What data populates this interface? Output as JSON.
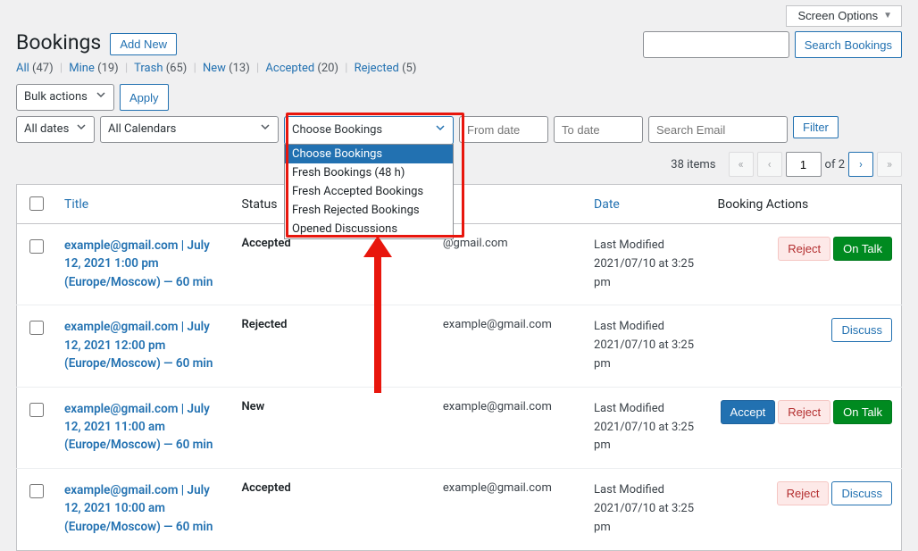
{
  "screen_options_label": "Screen Options",
  "page_title": "Bookings",
  "add_new_label": "Add New",
  "search": {
    "button": "Search Bookings"
  },
  "status_filters": [
    {
      "label": "All",
      "count": "(47)"
    },
    {
      "label": "Mine",
      "count": "(19)"
    },
    {
      "label": "Trash",
      "count": "(65)"
    },
    {
      "label": "New",
      "count": "(13)"
    },
    {
      "label": "Accepted",
      "count": "(20)"
    },
    {
      "label": "Rejected",
      "count": "(5)"
    }
  ],
  "bulk_actions_label": "Bulk actions",
  "apply_label": "Apply",
  "filter_row": {
    "all_dates": "All dates",
    "all_calendars": "All Calendars",
    "choose_bookings": "Choose Bookings",
    "from_date": "From date",
    "to_date": "To date",
    "search_email": "Search Email",
    "filter": "Filter"
  },
  "dropdown_options": [
    "Choose Bookings",
    "Fresh Bookings (48 h)",
    "Fresh Accepted Bookings",
    "Fresh Rejected Bookings",
    "Opened Discussions"
  ],
  "pagination": {
    "items_text": "38 items",
    "current": "1",
    "of_text": "of 2"
  },
  "columns": {
    "title": "Title",
    "status": "Status",
    "date": "Date",
    "actions": "Booking Actions"
  },
  "date_label": "Last Modified",
  "rows": [
    {
      "title": "example@gmail.com | July 12, 2021 1:00 pm (Europe/Moscow) — 60 min",
      "status": "Accepted",
      "email": "@gmail.com",
      "date": "2021/07/10 at 3:25 pm",
      "actions": [
        "Reject",
        "On Talk"
      ]
    },
    {
      "title": "example@gmail.com | July 12, 2021 12:00 pm (Europe/Moscow) — 60 min",
      "status": "Rejected",
      "email": "example@gmail.com",
      "date": "2021/07/10 at 3:25 pm",
      "actions": [
        "Discuss"
      ]
    },
    {
      "title": "example@gmail.com | July 12, 2021 11:00 am (Europe/Moscow) — 60 min",
      "status": "New",
      "email": "example@gmail.com",
      "date": "2021/07/10 at 3:25 pm",
      "actions": [
        "Accept",
        "Reject",
        "On Talk"
      ]
    },
    {
      "title": "example@gmail.com | July 12, 2021 10:00 am (Europe/Moscow) — 60 min",
      "status": "Accepted",
      "email": "example@gmail.com",
      "date": "2021/07/10 at 3:25 pm",
      "actions": [
        "Reject",
        "Discuss"
      ]
    }
  ],
  "action_labels": {
    "Reject": "Reject",
    "On Talk": "On Talk",
    "Accept": "Accept",
    "Discuss": "Discuss"
  }
}
